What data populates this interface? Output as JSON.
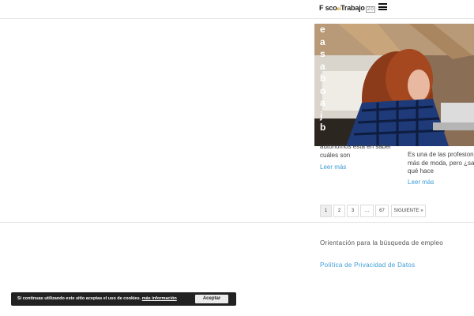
{
  "header": {
    "logo_text": "F sco",
    "logo_mid": "el",
    "logo_end": "Trabajo",
    "logo_box": "2.0",
    "menu_icon": "hamburger-icon"
  },
  "post1": {
    "vertical_title_chars": [
      "e",
      "a",
      "s",
      "a",
      "b",
      "o",
      "a",
      "j",
      "b"
    ],
    "excerpt_line1": "autónomos está en saber",
    "excerpt_line2": "cuáles son",
    "read_more": "Leer más"
  },
  "post2": {
    "excerpt_line1": "Es una de las profesiones",
    "excerpt_line2": "más de moda, pero ¿sab",
    "excerpt_line3": "qué hace",
    "read_more": "Leer más"
  },
  "pagination": {
    "pages": [
      "1",
      "2",
      "3",
      "…",
      "67"
    ],
    "next": "SIGUIENTE »",
    "current": "1"
  },
  "footer": {
    "text": "Orientación para la búsqueda de empleo",
    "privacy_link": "Política de Privacidad de Datos"
  },
  "cookie": {
    "text": "Si continuas utilizando este sitio aceptas el uso de cookies.",
    "link": "más información",
    "accept": "Aceptar"
  },
  "colors": {
    "link": "#3c9cd6",
    "cookie_bg": "#222222"
  }
}
